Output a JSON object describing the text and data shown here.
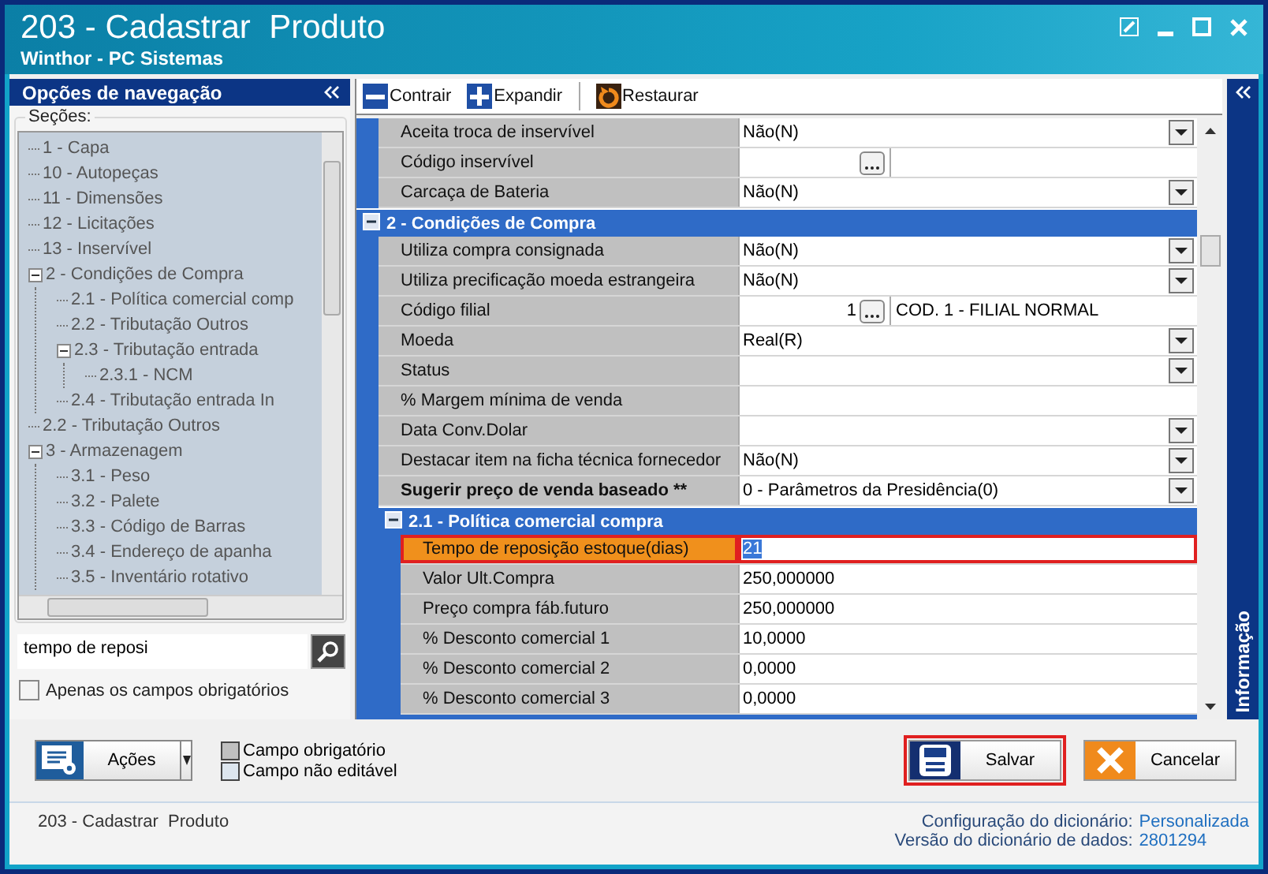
{
  "window": {
    "title": "203 - Cadastrar  Produto",
    "subtitle": "Winthor - PC Sistemas"
  },
  "navigation": {
    "title": "Opções de navegação",
    "sections_label": "Seções:",
    "tree": [
      {
        "label": "1 - Capa"
      },
      {
        "label": "10 - Autopeças"
      },
      {
        "label": "11 - Dimensões"
      },
      {
        "label": "12 - Licitações"
      },
      {
        "label": "13 - Inservível"
      },
      {
        "label": "2 - Condições de Compra",
        "expanded": true,
        "children": [
          {
            "label": "2.1 - Política comercial comp"
          },
          {
            "label": "2.2 - Tributação Outros"
          },
          {
            "label": "2.3 - Tributação entrada",
            "expanded": true,
            "children": [
              {
                "label": "2.3.1 - NCM"
              }
            ]
          },
          {
            "label": "2.4 - Tributação entrada In"
          }
        ]
      },
      {
        "label": "2.2 - Tributação Outros"
      },
      {
        "label": "3 - Armazenagem",
        "expanded": true,
        "children": [
          {
            "label": "3.1 - Peso"
          },
          {
            "label": "3.2 - Palete"
          },
          {
            "label": "3.3 - Código de Barras"
          },
          {
            "label": "3.4 - Endereço de apanha"
          },
          {
            "label": "3.5 - Inventário rotativo"
          }
        ]
      }
    ],
    "search": {
      "value": "tempo de reposi"
    },
    "required_only": {
      "label": "Apenas os campos obrigatórios",
      "checked": false
    }
  },
  "toolbar": [
    {
      "kind": "collapse",
      "label": "Contrair"
    },
    {
      "kind": "expand",
      "label": "Expandir"
    },
    {
      "kind": "restore",
      "label": "Restaurar"
    }
  ],
  "grid": {
    "items": [
      {
        "kind": "dropdown",
        "label": "Aceita troca de inservível",
        "value": "Não(N)",
        "bold": false,
        "selected": false
      },
      {
        "kind": "lookup",
        "label": "Código inservível",
        "bold": false,
        "selected": false
      },
      {
        "kind": "dropdown",
        "label": "Carcaça de Bateria",
        "value": "Não(N)",
        "bold": false,
        "selected": false
      },
      {
        "kind": "category",
        "title": "2 - Condições de Compra",
        "expanded": true,
        "children": [
          {
            "kind": "dropdown",
            "label": "Utiliza compra consignada",
            "value": "Não(N)",
            "bold": false,
            "selected": false
          },
          {
            "kind": "dropdown",
            "label": "Utiliza precificação moeda estrangeira",
            "value": "Não(N)",
            "bold": false,
            "selected": false
          },
          {
            "kind": "lookup",
            "label": "Código filial",
            "value": "1",
            "description": "COD. 1 - FILIAL NORMAL",
            "bold": false,
            "selected": false
          },
          {
            "kind": "dropdown",
            "label": "Moeda",
            "value": "Real(R)",
            "bold": false,
            "selected": false
          },
          {
            "kind": "dropdown",
            "label": "Status",
            "bold": false,
            "selected": false
          },
          {
            "kind": "text",
            "label": "% Margem mínima de venda",
            "bold": false,
            "selected": false
          },
          {
            "kind": "dropdown",
            "label": "Data Conv.Dolar",
            "bold": false,
            "selected": false
          },
          {
            "kind": "dropdown",
            "label": "Destacar item na ficha técnica fornecedor",
            "value": "Não(N)",
            "bold": false,
            "selected": false
          },
          {
            "kind": "dropdown",
            "label": "Sugerir preço de venda baseado **",
            "value": "0 - Parâmetros da Presidência(0)",
            "bold": true,
            "selected": false
          },
          {
            "kind": "category",
            "title": "2.1 - Política comercial compra",
            "expanded": true,
            "children": [
              {
                "kind": "text",
                "label": "Tempo de reposição estoque(dias)",
                "value": "21",
                "bold": false,
                "selected": true
              },
              {
                "kind": "text",
                "label": "Valor Ult.Compra",
                "value": "250,000000",
                "bold": false,
                "selected": false
              },
              {
                "kind": "text",
                "label": "Preço compra fáb.futuro",
                "value": "250,000000",
                "bold": false,
                "selected": false
              },
              {
                "kind": "text",
                "label": "% Desconto comercial 1",
                "value": "10,0000",
                "bold": false,
                "selected": false
              },
              {
                "kind": "text",
                "label": "% Desconto comercial 2",
                "value": "0,0000",
                "bold": false,
                "selected": false
              },
              {
                "kind": "text",
                "label": "% Desconto comercial 3",
                "value": "0,0000",
                "bold": false,
                "selected": false
              }
            ]
          }
        ]
      }
    ]
  },
  "info_panel": {
    "title": "Informação"
  },
  "actions_button": {
    "label": "Ações"
  },
  "legend": [
    {
      "kind": "required",
      "label": "Campo obrigatório"
    },
    {
      "kind": "readonly",
      "label": "Campo não editável"
    }
  ],
  "buttons": [
    {
      "kind": "save",
      "label": "Salvar"
    },
    {
      "kind": "cancel",
      "label": "Cancelar"
    }
  ],
  "status_bar": {
    "title": "203 - Cadastrar  Produto",
    "config_label": "Configuração do dicionário:",
    "config_value": "Personalizada",
    "version_label": "Versão do dicionário de dados:",
    "version_value": "2801294"
  }
}
